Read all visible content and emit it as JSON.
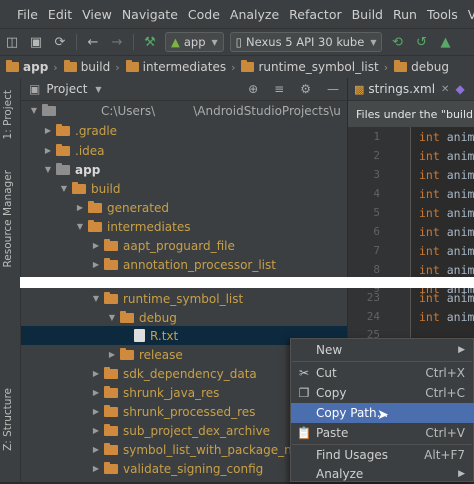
{
  "menubar": {
    "items": [
      "File",
      "Edit",
      "View",
      "Navigate",
      "Code",
      "Analyze",
      "Refactor",
      "Build",
      "Run",
      "Tools",
      "VCS"
    ]
  },
  "toolbar": {
    "module_combo": "app",
    "device_combo": "Nexus 5 API 30 kube"
  },
  "breadcrumb": [
    "app",
    "build",
    "intermediates",
    "runtime_symbol_list",
    "debug"
  ],
  "side_tabs": {
    "project": "1: Project",
    "resource_manager": "Resource Manager",
    "structure": "Z: Structure"
  },
  "project_panel": {
    "title": "Project",
    "root_path": "C:\\Users\\          \\AndroidStudioProjects\\u",
    "tree": [
      {
        "label": "app"
      },
      {
        "label": ".gradle"
      },
      {
        "label": ".idea"
      },
      {
        "label": "app"
      },
      {
        "label": "build"
      },
      {
        "label": "generated"
      },
      {
        "label": "intermediates"
      },
      {
        "label": "aapt_proguard_file"
      },
      {
        "label": "annotation_processor_list"
      },
      {
        "label": "runtime_symbol_list"
      },
      {
        "label": "debug"
      },
      {
        "label": "R.txt"
      },
      {
        "label": "release"
      },
      {
        "label": "sdk_dependency_data"
      },
      {
        "label": "shrunk_java_res"
      },
      {
        "label": "shrunk_processed_res"
      },
      {
        "label": "sub_project_dex_archive"
      },
      {
        "label": "symbol_list_with_package_name"
      },
      {
        "label": "validate_signing_config"
      }
    ]
  },
  "editor": {
    "tab": "strings.xml",
    "banner": "Files under the \"build\" f",
    "line_numbers": [
      "1",
      "2",
      "3",
      "4",
      "5",
      "6",
      "7",
      "8",
      "9",
      "23",
      "24",
      "25"
    ],
    "code_keyword": "int",
    "code_text": "anim"
  },
  "context_menu": {
    "items": [
      {
        "label": "New",
        "shortcut": ""
      },
      {
        "label": "Cut",
        "shortcut": "Ctrl+X"
      },
      {
        "label": "Copy",
        "shortcut": "Ctrl+C"
      },
      {
        "label": "Copy Path...",
        "shortcut": ""
      },
      {
        "label": "Paste",
        "shortcut": "Ctrl+V"
      },
      {
        "label": "Find Usages",
        "shortcut": "Alt+F7"
      },
      {
        "label": "Analyze",
        "shortcut": ""
      }
    ]
  },
  "colors": {
    "highlight": "#4b6eaf",
    "folder": "#d08a3e",
    "selection": "#0d293e"
  }
}
